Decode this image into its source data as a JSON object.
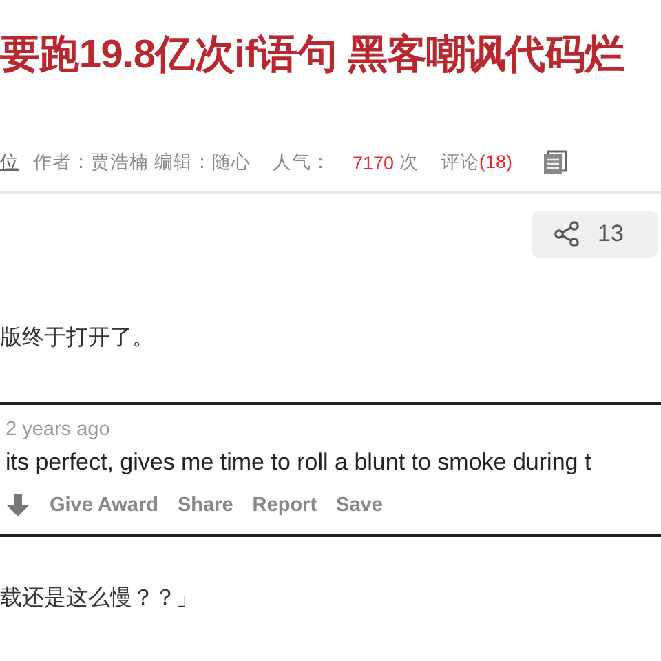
{
  "article": {
    "title": "要跑19.8亿次if语句 黑客嘲讽代码烂",
    "meta": {
      "source": "位",
      "author_label": "作者：",
      "author": "贾浩楠",
      "editor_label": "编辑：",
      "editor": "随心",
      "views_label": "人气：",
      "views": "7170",
      "views_unit": "次",
      "comments_label": "评论",
      "comments": "(18)"
    },
    "share": {
      "count": "13"
    },
    "paragraph_1": "版终于打开了。",
    "embedded_comment": {
      "time": "2 years ago",
      "text": "its perfect, gives me time to roll a blunt to smoke during t",
      "actions": [
        "Give Award",
        "Share",
        "Report",
        "Save"
      ]
    },
    "paragraph_2": "载还是这么慢？？」"
  }
}
